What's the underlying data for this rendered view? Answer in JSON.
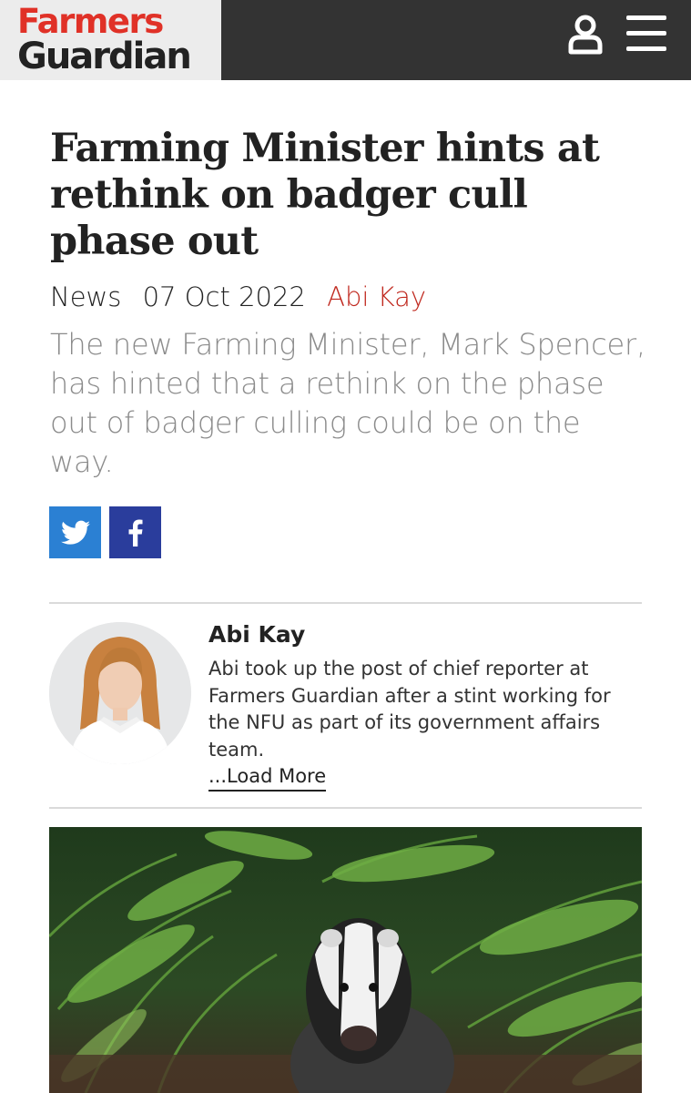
{
  "header": {
    "logo_line1": "Farmers",
    "logo_line2": "Guardian",
    "colors": {
      "bar": "#333333",
      "logo_red": "#e03127"
    },
    "icons": [
      "user-icon",
      "hamburger-menu-icon"
    ]
  },
  "article": {
    "title": "Farming Minister hints at rethink on badger cull phase out",
    "category": "News",
    "date": "07 Oct 2022",
    "author": "Abi Kay",
    "standfirst": "The new Farming Minister, Mark Spencer, has hinted that a rethink on the phase out of badger culling could be on the way."
  },
  "share": {
    "twitter_icon": "twitter-bird-icon",
    "facebook_icon": "facebook-f-icon",
    "twitter_color": "#2b80d3",
    "facebook_color": "#2a3d9c"
  },
  "author_box": {
    "name": "Abi Kay",
    "bio": "Abi took up the post of chief reporter at Farmers Guardian after a stint working for the NFU as part of its government affairs team.",
    "load_more": "...Load More"
  }
}
